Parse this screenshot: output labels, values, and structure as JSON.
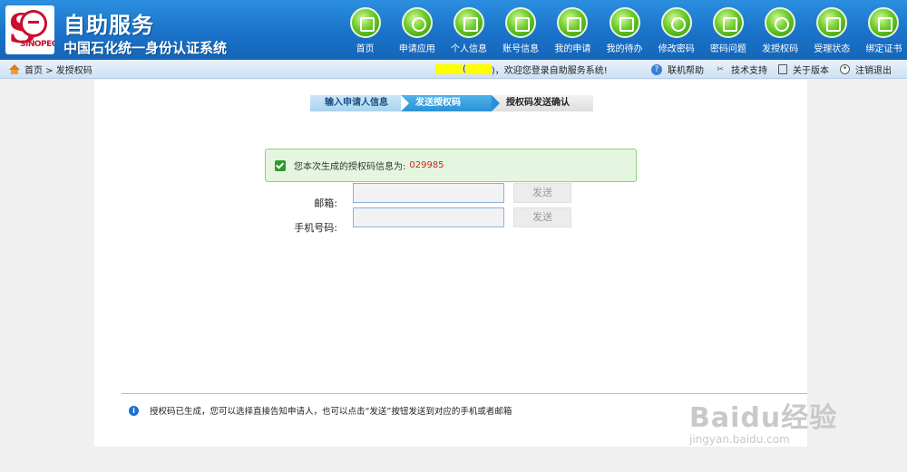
{
  "header": {
    "title_main": "自助服务",
    "title_sub": "中国石化统一身份认证系统",
    "logo_text": "SINOPEC"
  },
  "nav": [
    {
      "label": "首页",
      "icon": "home-icon"
    },
    {
      "label": "申请应用",
      "icon": "plus-icon"
    },
    {
      "label": "个人信息",
      "icon": "id-card-icon"
    },
    {
      "label": "账号信息",
      "icon": "account-icon"
    },
    {
      "label": "我的申请",
      "icon": "document-icon"
    },
    {
      "label": "我的待办",
      "icon": "alert-icon"
    },
    {
      "label": "修改密码",
      "icon": "clock-icon"
    },
    {
      "label": "密码问题",
      "icon": "key-icon"
    },
    {
      "label": "发授权码",
      "icon": "lock-icon"
    },
    {
      "label": "受理状态",
      "icon": "status-icon"
    },
    {
      "label": "绑定证书",
      "icon": "calendar-icon"
    }
  ],
  "subbar": {
    "breadcrumb": "首页 > 发授权码",
    "welcome_open": "(",
    "welcome_text": ")，欢迎您登录自助服务系统!",
    "links": [
      {
        "label": "联机帮助",
        "icon": "help-icon"
      },
      {
        "label": "技术支持",
        "icon": "tools-icon"
      },
      {
        "label": "关于版本",
        "icon": "book-icon"
      },
      {
        "label": "注销退出",
        "icon": "logout-icon"
      }
    ]
  },
  "steps": [
    "输入申请人信息",
    "发送授权码",
    "授权码发送确认"
  ],
  "notice": {
    "text": "您本次生成的授权码信息为:",
    "code": "029985"
  },
  "form": {
    "email_label": "邮箱:",
    "phone_label": "手机号码:",
    "send_label": "发送"
  },
  "info": "授权码已生成，您可以选择直接告知申请人，也可以点击“发送”按钮发送到对应的手机或者邮箱",
  "watermark": {
    "big": "Baidu经验",
    "small": "jingyan.baidu.com"
  }
}
